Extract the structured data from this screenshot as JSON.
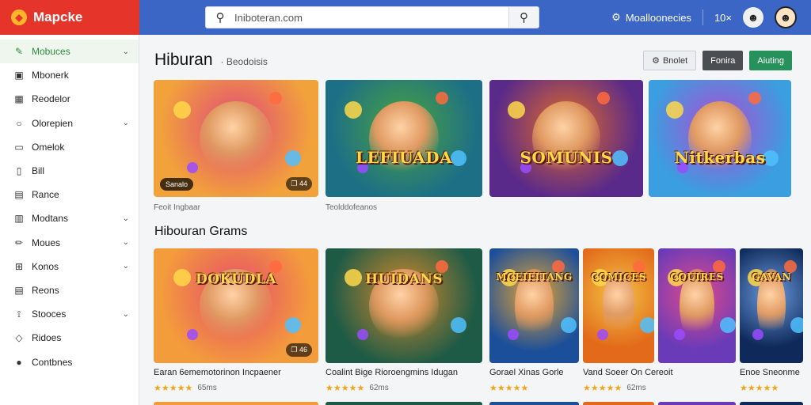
{
  "app": {
    "name": "Mapcke",
    "logo_glyph": "◆"
  },
  "search": {
    "placeholder": "",
    "value": "Iniboteran.com"
  },
  "topbar": {
    "link_label": "Moalloonecies",
    "count_label": "10×",
    "accent": "#3b66c6",
    "brand_color": "#e5342a"
  },
  "sidebar": {
    "items": [
      {
        "label": "Mobuces",
        "icon": "gamepad-icon",
        "glyph": "✎",
        "chevron": true,
        "active": true
      },
      {
        "label": "Mbonerk",
        "icon": "bag-icon",
        "glyph": "▣",
        "chevron": false
      },
      {
        "label": "Reodelor",
        "icon": "shop-icon",
        "glyph": "▦",
        "chevron": false
      },
      {
        "label": "Olorepien",
        "icon": "circle-icon",
        "glyph": "○",
        "chevron": true
      },
      {
        "label": "Omelok",
        "icon": "folder-icon",
        "glyph": "▭",
        "chevron": false
      },
      {
        "label": "Bill",
        "icon": "document-icon",
        "glyph": "▯",
        "chevron": false
      },
      {
        "label": "Rance",
        "icon": "grid-icon",
        "glyph": "▤",
        "chevron": false
      },
      {
        "label": "Modtans",
        "icon": "inbox-icon",
        "glyph": "▥",
        "chevron": true
      },
      {
        "label": "Moues",
        "icon": "pencil-icon",
        "glyph": "✏",
        "chevron": true
      },
      {
        "label": "Konos",
        "icon": "box-icon",
        "glyph": "⊞",
        "chevron": true
      },
      {
        "label": "Reons",
        "icon": "clipboard-icon",
        "glyph": "▤",
        "chevron": false
      },
      {
        "label": "Stooces",
        "icon": "pin-icon",
        "glyph": "⟟",
        "chevron": true
      },
      {
        "label": "Ridoes",
        "icon": "diamond-icon",
        "glyph": "◇",
        "chevron": false
      },
      {
        "label": "Contbnes",
        "icon": "coin-icon",
        "glyph": "●",
        "chevron": false
      }
    ]
  },
  "main": {
    "title": "Hiburan",
    "subtitle": "· Beodoisis",
    "actions": [
      {
        "label": "Bnolet",
        "style": "light"
      },
      {
        "label": "Fonira",
        "style": "dark"
      },
      {
        "label": "Aiuting",
        "style": "green"
      }
    ],
    "featured": [
      {
        "art_title": "",
        "tag": "Sanalo",
        "tag_right": "❐ 44",
        "caption": "Feoit Ingbaar",
        "colors": [
          "#f2a23b",
          "#e0487a"
        ]
      },
      {
        "art_title": "LEFIUADA",
        "tag": "",
        "tag_right": "",
        "caption": "Teolddofeanos",
        "colors": [
          "#1d6f86",
          "#4ba33e"
        ]
      },
      {
        "art_title": "SOMUNIS",
        "tag": "",
        "tag_right": "",
        "caption": "",
        "colors": [
          "#5a2a8a",
          "#e46b25"
        ]
      },
      {
        "art_title": "Nitkerbas",
        "tag": "",
        "tag_right": "",
        "caption": "",
        "colors": [
          "#3a9ee0",
          "#b14bd1"
        ]
      }
    ],
    "section2_title": "Hibouran Grams",
    "games": [
      {
        "art_title": "DOKUDLA",
        "name": "Earan 6ememotorinon Incpaener",
        "count": "65ms",
        "tag_right": "❐ 46",
        "colors": [
          "#f39c3c",
          "#e64a6b"
        ]
      },
      {
        "art_title": "HUIDANS",
        "name": "Coalint Bige Rioroengmins Idugan",
        "count": "62ms",
        "tag_right": "",
        "colors": [
          "#1e5b46",
          "#d88a2b"
        ]
      },
      {
        "art_title": "MCEIEITANG",
        "name": "Gorael Xinas Gorle",
        "count": "",
        "tag_right": "",
        "colors": [
          "#1b4f9a",
          "#e8a531"
        ]
      },
      {
        "art_title": "COMICES",
        "name": "Vand Soeer On Cereoit",
        "count": "62ms",
        "tag_right": "",
        "colors": [
          "#e26a1a",
          "#f3c244"
        ]
      },
      {
        "art_title": "COUIRES",
        "name": "",
        "count": "",
        "tag_right": "",
        "colors": [
          "#6a3bb8",
          "#e24a8a"
        ]
      },
      {
        "art_title": "GAVAN",
        "name": "Enoe Sneonme",
        "count": "",
        "tag_right": "",
        "colors": [
          "#0f2a5a",
          "#6a9be0"
        ]
      }
    ],
    "stars": "★★★★★"
  }
}
